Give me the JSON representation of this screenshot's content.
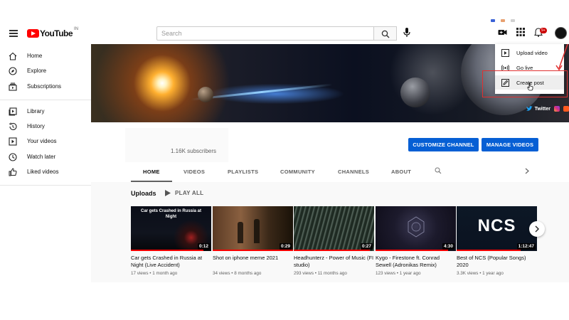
{
  "header": {
    "logo_text": "YouTube",
    "logo_region": "IN",
    "search_placeholder": "Search",
    "notification_count": "9+"
  },
  "sidebar": {
    "items": [
      {
        "label": "Home",
        "icon": "home-icon"
      },
      {
        "label": "Explore",
        "icon": "compass-icon"
      },
      {
        "label": "Subscriptions",
        "icon": "subscriptions-icon"
      },
      {
        "label": "Library",
        "icon": "library-icon"
      },
      {
        "label": "History",
        "icon": "history-icon"
      },
      {
        "label": "Your videos",
        "icon": "your-videos-icon"
      },
      {
        "label": "Watch later",
        "icon": "clock-icon"
      },
      {
        "label": "Liked videos",
        "icon": "thumbs-up-icon"
      }
    ]
  },
  "create_menu": {
    "items": [
      {
        "label": "Upload video",
        "icon": "upload-video-icon"
      },
      {
        "label": "Go live",
        "icon": "live-icon"
      },
      {
        "label": "Create post",
        "icon": "create-post-icon"
      }
    ]
  },
  "banner": {
    "twitter_label": "Twitter"
  },
  "channel": {
    "subscribers": "1.16K subscribers",
    "customize_label": "CUSTOMIZE CHANNEL",
    "manage_label": "MANAGE VIDEOS",
    "tabs": [
      "HOME",
      "VIDEOS",
      "PLAYLISTS",
      "COMMUNITY",
      "CHANNELS",
      "ABOUT"
    ]
  },
  "uploads": {
    "title": "Uploads",
    "play_all": "PLAY ALL",
    "videos": [
      {
        "thumb_text": "Car gets Crashed in Russia at Night",
        "duration": "0:12",
        "title": "Car gets Crashed in Russia at Night (Live Accident)",
        "meta": "17 views • 1 month ago",
        "progress": 0.9
      },
      {
        "thumb_text": "",
        "duration": "0:29",
        "title": "Shot on iphone meme 2021",
        "meta": "34 views • 8 months ago",
        "progress": 1.0
      },
      {
        "thumb_text": "",
        "duration": "0:27",
        "title": "Headhunterz - Power of Music (FI studio)",
        "meta": "293 views • 11 months ago",
        "progress": 0.95
      },
      {
        "thumb_text": "",
        "duration": "4:30",
        "title": "Kygo - Firestone ft. Conrad Sewell (Adronikas Remix)",
        "meta": "123 views • 1 year ago",
        "progress": 0.9
      },
      {
        "thumb_text": "NCS",
        "duration": "1:12:47",
        "title": "Best of NCS (Popular Songs) 2020",
        "meta": "3.3K views • 1 year ago",
        "progress": 0.8
      }
    ]
  },
  "colors": {
    "brand_red": "#ff0000",
    "button_blue": "#065fd4",
    "highlight_red": "#e03030"
  }
}
